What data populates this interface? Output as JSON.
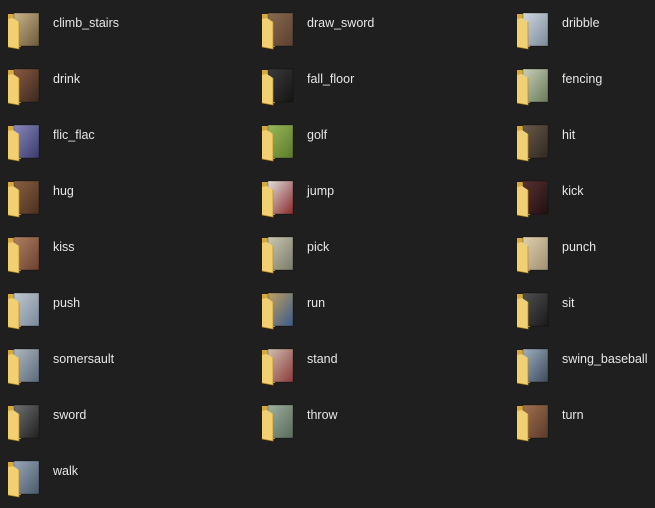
{
  "explorer": {
    "view_mode": "large-icons",
    "folders": [
      {
        "name": "climb_stairs",
        "thumb": [
          "#6b5a3a",
          "#c9b48a"
        ]
      },
      {
        "name": "draw_sword",
        "thumb": [
          "#5a4030",
          "#8a6a50"
        ]
      },
      {
        "name": "dribble",
        "thumb": [
          "#7a8a9a",
          "#d0d8e0"
        ]
      },
      {
        "name": "drink",
        "thumb": [
          "#3a2820",
          "#8a5a40"
        ]
      },
      {
        "name": "fall_floor",
        "thumb": [
          "#151515",
          "#3a3a3a"
        ]
      },
      {
        "name": "fencing",
        "thumb": [
          "#6a7a5a",
          "#c8d0b8"
        ]
      },
      {
        "name": "flic_flac",
        "thumb": [
          "#3a3a6a",
          "#8888bb"
        ]
      },
      {
        "name": "golf",
        "thumb": [
          "#5a7a2a",
          "#9ab85a"
        ]
      },
      {
        "name": "hit",
        "thumb": [
          "#302820",
          "#6a5a4a"
        ]
      },
      {
        "name": "hug",
        "thumb": [
          "#4a3020",
          "#8a6040"
        ]
      },
      {
        "name": "jump",
        "thumb": [
          "#8a2a2a",
          "#e0e0e0"
        ]
      },
      {
        "name": "kick",
        "thumb": [
          "#201010",
          "#5a3030"
        ]
      },
      {
        "name": "kiss",
        "thumb": [
          "#6a4030",
          "#b08060"
        ]
      },
      {
        "name": "pick",
        "thumb": [
          "#7a7a6a",
          "#c8c8b0"
        ]
      },
      {
        "name": "punch",
        "thumb": [
          "#a09070",
          "#e0d0b0"
        ]
      },
      {
        "name": "push",
        "thumb": [
          "#7a8a9a",
          "#c0c8d0"
        ]
      },
      {
        "name": "run",
        "thumb": [
          "#3a5a8a",
          "#c0a060"
        ]
      },
      {
        "name": "sit",
        "thumb": [
          "#1a1a1a",
          "#505050"
        ]
      },
      {
        "name": "somersault",
        "thumb": [
          "#5a6a7a",
          "#b0b8c0"
        ]
      },
      {
        "name": "stand",
        "thumb": [
          "#8a3a3a",
          "#d0c0b0"
        ]
      },
      {
        "name": "swing_baseball",
        "thumb": [
          "#3a4a5a",
          "#a0b0c0"
        ]
      },
      {
        "name": "sword",
        "thumb": [
          "#202020",
          "#707070"
        ]
      },
      {
        "name": "throw",
        "thumb": [
          "#5a6a5a",
          "#a0b0a0"
        ]
      },
      {
        "name": "turn",
        "thumb": [
          "#5a3a2a",
          "#a07050"
        ]
      },
      {
        "name": "walk",
        "thumb": [
          "#4a5a6a",
          "#9aa8b8"
        ]
      }
    ]
  },
  "colors": {
    "background": "#1f1f1f",
    "text": "#e6e6e6",
    "folder_back": "#d9a93a",
    "folder_front": "#f2cf70"
  }
}
